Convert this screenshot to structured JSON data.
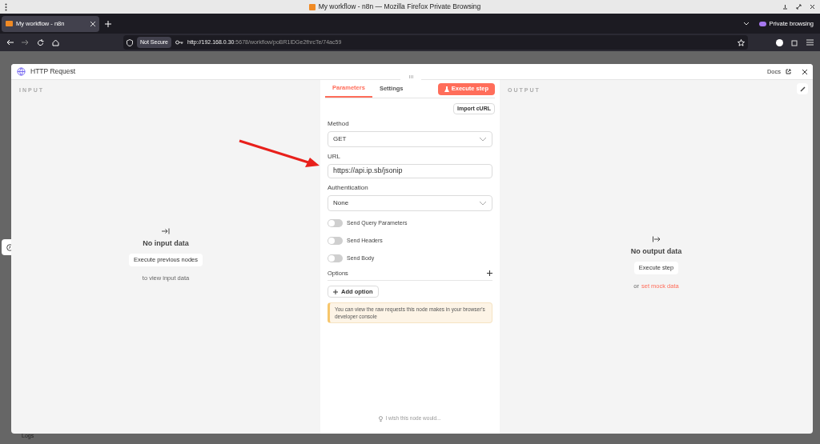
{
  "window": {
    "title": "My workflow - n8n — Mozilla Firefox Private Browsing"
  },
  "browser": {
    "tab_title": "My workflow - n8n",
    "private_label": "Private browsing",
    "not_secure": "Not Secure",
    "url_host": "http://192.168.0.30",
    "url_rest": ":5678/workflow/poBR1lDGe2fhrcTe/74ac59"
  },
  "sidebar": {
    "logs": "Logs"
  },
  "node": {
    "title": "HTTP Request",
    "docs": "Docs"
  },
  "input": {
    "heading": "INPUT",
    "empty_title": "No input data",
    "button": "Execute previous nodes",
    "hint": "to view input data"
  },
  "params": {
    "tabs": [
      {
        "label": "Parameters",
        "selected": true
      },
      {
        "label": "Settings",
        "selected": false
      }
    ],
    "execute": "Execute step",
    "import": "Import cURL",
    "fields": [
      {
        "label": "Method",
        "kind": "select",
        "value": "GET"
      },
      {
        "label": "URL",
        "kind": "text",
        "value": "https://api.ip.sb/jsonip"
      },
      {
        "label": "Authentication",
        "kind": "select",
        "value": "None"
      }
    ],
    "toggles": [
      {
        "label": "Send Query Parameters",
        "on": false
      },
      {
        "label": "Send Headers",
        "on": false
      },
      {
        "label": "Send Body",
        "on": false
      }
    ],
    "options_label": "Options",
    "add_option": "Add option",
    "notice": "You can view the raw requests this node makes in your browser's developer console",
    "feedback": "I wish this node would..."
  },
  "output": {
    "heading": "OUTPUT",
    "empty_title": "No output data",
    "button": "Execute step",
    "or": "or",
    "mock_link": "set mock data"
  }
}
